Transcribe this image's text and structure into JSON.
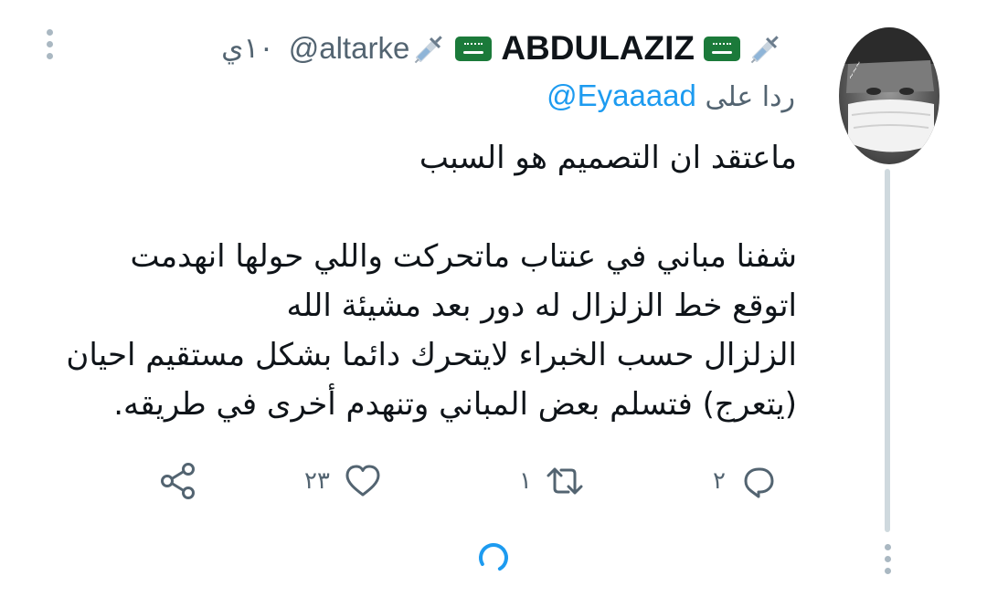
{
  "tweet": {
    "display_name": "ABDULAZIZ",
    "handle": "@altarke",
    "time": "١٠ي",
    "reply_prefix": "ردا على",
    "reply_handle": "@Eyaaaad",
    "lines": [
      "ماعتقد ان التصميم هو السبب",
      "",
      "شفنا مباني في عنتاب ماتحركت واللي حولها انهدمت",
      "اتوقع خط الزلزال له دور بعد مشيئة الله",
      "الزلزال حسب الخبراء لايتحرك دائما بشكل مستقيم احيان",
      "(يتعرج) فتسلم بعض المباني وتنهدم أخرى في طريقه."
    ]
  },
  "actions": {
    "reply_count": "٢",
    "retweet_count": "١",
    "like_count": "٢٣"
  },
  "colors": {
    "link_blue": "#1d9bf0",
    "muted_gray": "#536471",
    "flag_green": "#1b7a3a",
    "thread_line": "#cfd9de"
  },
  "icons": {
    "reply": "reply-icon",
    "retweet": "retweet-icon",
    "like": "heart-icon",
    "share": "share-icon",
    "loading": "loading-spinner-icon",
    "more": "more-options-icon"
  }
}
